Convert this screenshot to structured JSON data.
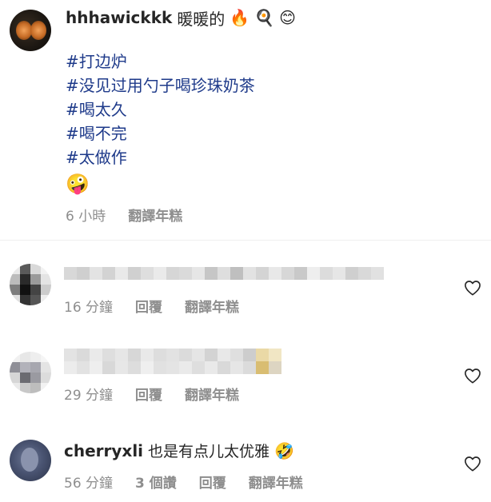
{
  "post": {
    "username": "hhhawickkk",
    "title_text": "暖暖的",
    "title_emojis": [
      "🔥",
      "🍳",
      "😊"
    ],
    "hashtags": [
      "#打边炉",
      "#没见过用勺子喝珍珠奶茶",
      "#喝太久",
      "#喝不完",
      "#太做作"
    ],
    "trailing_emoji": "🤪",
    "time": "6 小時",
    "translate": "翻譯年糕"
  },
  "comments": [
    {
      "username": "",
      "text": "",
      "time": "16 分鐘",
      "reply": "回覆",
      "translate": "翻譯年糕",
      "likes": ""
    },
    {
      "username": "",
      "text": "",
      "time": "29 分鐘",
      "reply": "回覆",
      "translate": "翻譯年糕",
      "likes": ""
    },
    {
      "username": "cherryxli",
      "text": "也是有点儿太优雅",
      "emoji": "🤣",
      "time": "56 分鐘",
      "likes": "3 個讚",
      "reply": "回覆",
      "translate": "翻譯年糕"
    }
  ],
  "colors": {
    "text": "#262626",
    "muted": "#8e8e8e",
    "hashtag": "#1e3a8a",
    "divider": "#efefef"
  },
  "icons": {
    "like": "heart-outline-icon"
  }
}
